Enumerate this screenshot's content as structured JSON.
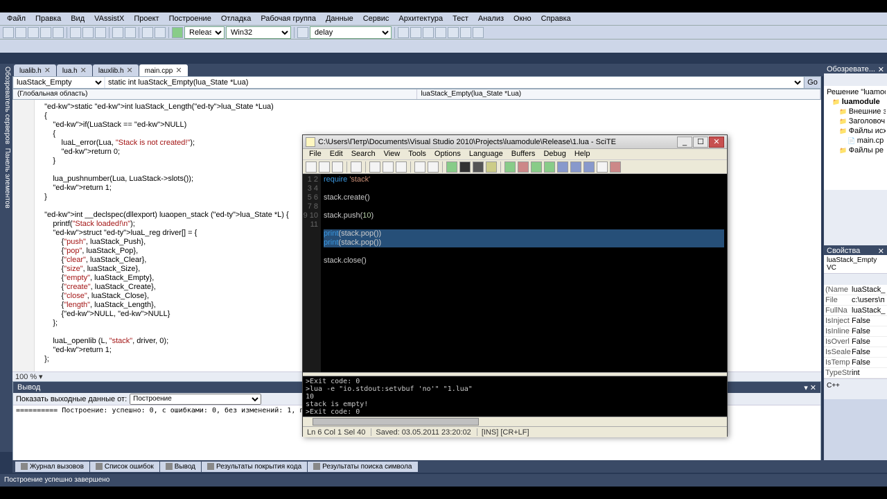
{
  "vs": {
    "menu": [
      "Файл",
      "Правка",
      "Вид",
      "VAssistX",
      "Проект",
      "Построение",
      "Отладка",
      "Рабочая группа",
      "Данные",
      "Сервис",
      "Архитектура",
      "Тест",
      "Анализ",
      "Окно",
      "Справка"
    ],
    "config": "Release",
    "platform": "Win32",
    "proj_combo": "delay",
    "tabs": [
      {
        "label": "lualib.h",
        "active": false
      },
      {
        "label": "lua.h",
        "active": false
      },
      {
        "label": "lauxlib.h",
        "active": false
      },
      {
        "label": "main.cpp",
        "active": true
      }
    ],
    "scope_left": "luaStack_Empty",
    "scope_right": "static int luaStack_Empty(lua_State *Lua)",
    "nav_left": "(Глобальная область)",
    "nav_right": "luaStack_Empty(lua_State *Lua)",
    "code": "  static int luaStack_Length(lua_State *Lua)\n  {\n      if(LuaStack == NULL)\n      {\n          luaL_error(Lua, \"Stack is not created!\");\n          return 0;\n      }\n\n      lua_pushnumber(Lua, LuaStack->slots());\n      return 1;\n  }\n\n  int __declspec(dllexport) luaopen_stack (lua_State *L) {\n      printf(\"Stack loaded!\\n\");\n      struct luaL_reg driver[] = {\n          {\"push\", luaStack_Push},\n          {\"pop\", luaStack_Pop},\n          {\"clear\", luaStack_Clear},\n          {\"size\", luaStack_Size},\n          {\"empty\", luaStack_Empty},\n          {\"create\", luaStack_Create},\n          {\"close\", luaStack_Close},\n          {\"length\", luaStack_Length},\n          {NULL, NULL}\n      };\n\n      luaL_openlib (L, \"stack\", driver, 0);\n      return 1;\n  };",
    "zoom": "100 %",
    "output_title": "Вывод",
    "output_src_label": "Показать выходные данные от:",
    "output_src": "Построение",
    "output_text": "========== Построение: успешно: 0, с ошибками: 0, без изменений: 1, пропущено: 0 ==========",
    "right_tabs": {
      "sol_title": "Обозревате...",
      "sol_root": "Решение \"luamod",
      "project": "luamodule",
      "folders": [
        "Внешние з",
        "Заголовоч",
        "Файлы исх"
      ],
      "file": "main.cp",
      "folder2": "Файлы ре",
      "props_title": "Свойства",
      "props_obj": "luaStack_Empty VC",
      "props": [
        {
          "k": "(Name",
          "v": "luaStack_E"
        },
        {
          "k": "File",
          "v": "c:\\users\\п"
        },
        {
          "k": "FullNa",
          "v": "luaStack_E"
        },
        {
          "k": "IsInject",
          "v": "False"
        },
        {
          "k": "IsInline",
          "v": "False"
        },
        {
          "k": "IsOverl",
          "v": "False"
        },
        {
          "k": "IsSeale",
          "v": "False"
        },
        {
          "k": "IsTemp",
          "v": "False"
        },
        {
          "k": "TypeStr",
          "v": "int"
        }
      ],
      "desc": "C++"
    },
    "bottom_tabs": [
      "Журнал вызовов",
      "Список ошибок",
      "Вывод",
      "Результаты покрытия кода",
      "Результаты поиска символа"
    ],
    "statusbar": "Построение успешно завершено"
  },
  "scite": {
    "title": "C:\\Users\\Петр\\Documents\\Visual Studio 2010\\Projects\\luamodule\\Release\\1.lua - SciTE",
    "menu": [
      "File",
      "Edit",
      "Search",
      "View",
      "Tools",
      "Options",
      "Language",
      "Buffers",
      "Debug",
      "Help"
    ],
    "gutter": [
      "1",
      "2",
      "3",
      "4",
      "5",
      "6",
      "7",
      "8",
      "9",
      "10",
      "11"
    ],
    "lines": [
      {
        "t": "require 'stack'",
        "cls": ""
      },
      {
        "t": "",
        "cls": ""
      },
      {
        "t": "stack.create()",
        "cls": ""
      },
      {
        "t": "",
        "cls": ""
      },
      {
        "t": "stack.push(10)",
        "cls": ""
      },
      {
        "t": "",
        "cls": ""
      },
      {
        "t": "print(stack.pop())",
        "cls": "sel"
      },
      {
        "t": "print(stack.pop())",
        "cls": "sel"
      },
      {
        "t": "",
        "cls": ""
      },
      {
        "t": "stack.close()",
        "cls": ""
      },
      {
        "t": "",
        "cls": ""
      }
    ],
    "output": ">Exit code: 0\n>lua -e \"io.stdout:setvbuf 'no'\" \"1.lua\"\n10\nstack is empty!\n>Exit code: 0",
    "status": {
      "pos": "Ln 6 Col 1 Sel 40",
      "saved": "Saved: 03.05.2011  23:20:02",
      "mode": "[INS] [CR+LF]"
    }
  }
}
